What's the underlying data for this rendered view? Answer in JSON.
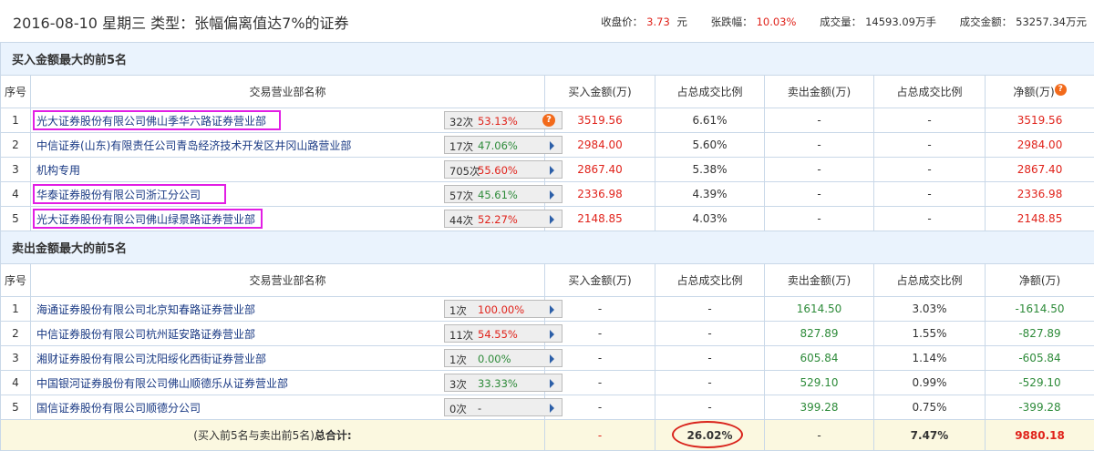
{
  "header": {
    "title": "2016-08-10 星期三  类型：张幅偏离值达7%的证券",
    "close_label": "收盘价：",
    "close": "3.73",
    "close_unit": "元",
    "change_label": "张跌幅：",
    "change": "10.03%",
    "volume_label": "成交量：",
    "volume": "14593.09万手",
    "amount_label": "成交金额：",
    "amount": "53257.34万元"
  },
  "columns": [
    "序号",
    "交易营业部名称",
    "买入金额(万)",
    "占总成交比例",
    "卖出金额(万)",
    "占总成交比例",
    "净额(万)"
  ],
  "buy_section": {
    "title": "买入金额最大的前5名",
    "rows": [
      {
        "no": "1",
        "name": "光大证券股份有限公司佛山季华六路证券营业部",
        "count": "32次",
        "rate": "53.13%",
        "buy": "3519.56",
        "buy_pct": "6.61%",
        "sell": "-",
        "sell_pct": "-",
        "net": "3519.56"
      },
      {
        "no": "2",
        "name": "中信证券(山东)有限责任公司青岛经济技术开发区井冈山路营业部",
        "count": "17次",
        "rate": "47.06%",
        "buy": "2984.00",
        "buy_pct": "5.60%",
        "sell": "-",
        "sell_pct": "-",
        "net": "2984.00"
      },
      {
        "no": "3",
        "name": "机构专用",
        "count": "705次",
        "rate": "55.60%",
        "buy": "2867.40",
        "buy_pct": "5.38%",
        "sell": "-",
        "sell_pct": "-",
        "net": "2867.40"
      },
      {
        "no": "4",
        "name": "华泰证券股份有限公司浙江分公司",
        "count": "57次",
        "rate": "45.61%",
        "buy": "2336.98",
        "buy_pct": "4.39%",
        "sell": "-",
        "sell_pct": "-",
        "net": "2336.98"
      },
      {
        "no": "5",
        "name": "光大证券股份有限公司佛山绿景路证券营业部",
        "count": "44次",
        "rate": "52.27%",
        "buy": "2148.85",
        "buy_pct": "4.03%",
        "sell": "-",
        "sell_pct": "-",
        "net": "2148.85"
      }
    ]
  },
  "sell_section": {
    "title": "卖出金额最大的前5名",
    "rows": [
      {
        "no": "1",
        "name": "海通证券股份有限公司北京知春路证券营业部",
        "count": "1次",
        "rate": "100.00%",
        "buy": "-",
        "buy_pct": "-",
        "sell": "1614.50",
        "sell_pct": "3.03%",
        "net": "-1614.50"
      },
      {
        "no": "2",
        "name": "中信证券股份有限公司杭州延安路证券营业部",
        "count": "11次",
        "rate": "54.55%",
        "buy": "-",
        "buy_pct": "-",
        "sell": "827.89",
        "sell_pct": "1.55%",
        "net": "-827.89"
      },
      {
        "no": "3",
        "name": "湘财证券股份有限公司沈阳绥化西街证券营业部",
        "count": "1次",
        "rate": "0.00%",
        "buy": "-",
        "buy_pct": "-",
        "sell": "605.84",
        "sell_pct": "1.14%",
        "net": "-605.84"
      },
      {
        "no": "4",
        "name": "中国银河证券股份有限公司佛山顺德乐从证券营业部",
        "count": "3次",
        "rate": "33.33%",
        "buy": "-",
        "buy_pct": "-",
        "sell": "529.10",
        "sell_pct": "0.99%",
        "net": "-529.10"
      },
      {
        "no": "5",
        "name": "国信证券股份有限公司顺德分公司",
        "count": "0次",
        "rate": "-",
        "buy": "-",
        "buy_pct": "-",
        "sell": "399.28",
        "sell_pct": "0.75%",
        "net": "-399.28"
      }
    ]
  },
  "total": {
    "label_a": "(买入前5名与卖出前5名)",
    "label_b": "总合计:",
    "buy": "-",
    "buy_pct": "26.02%",
    "sell": "-",
    "sell_pct": "7.47%",
    "net": "9880.18"
  },
  "colors": {
    "up": "#e0231b",
    "down": "#2e8b3a",
    "highlight": "#e21ee4"
  }
}
